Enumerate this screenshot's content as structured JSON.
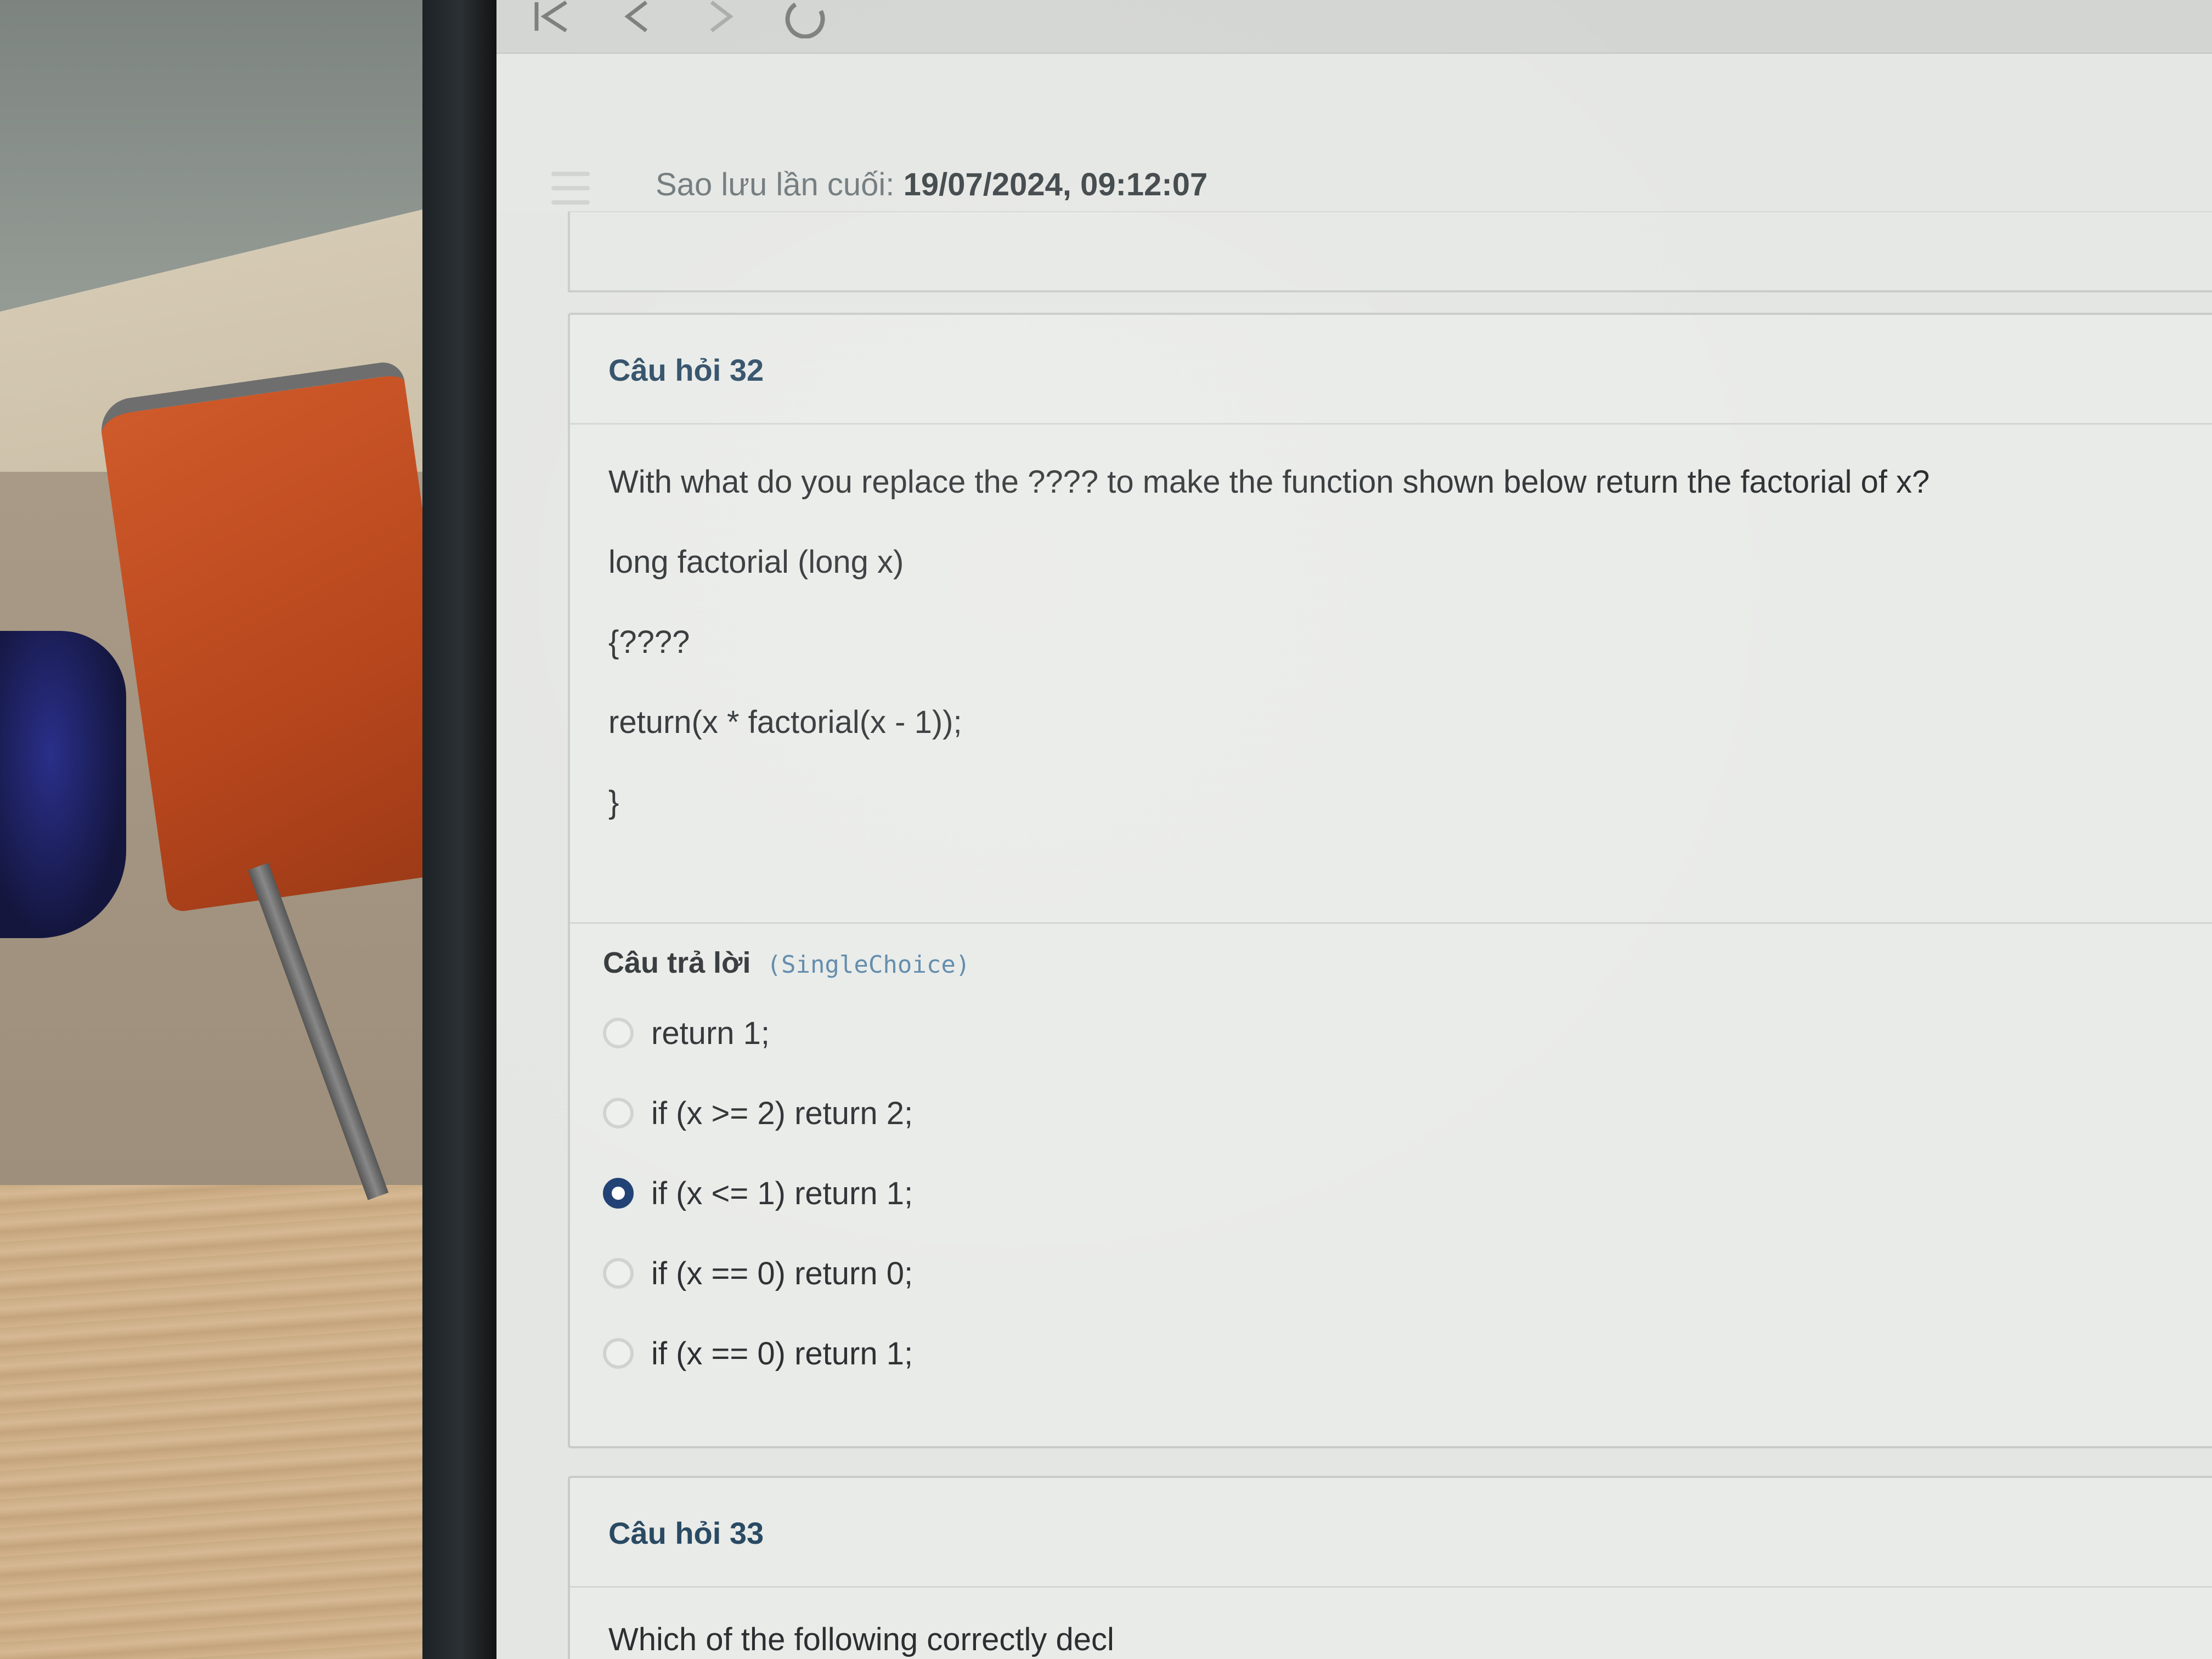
{
  "browser": {
    "icons": [
      "first-page-icon",
      "back-icon",
      "forward-icon",
      "reload-icon"
    ]
  },
  "header": {
    "save_label": "Sao lưu lần cuối:",
    "save_time": "19/07/2024, 09:12:07"
  },
  "question32": {
    "title": "Câu hỏi 32",
    "prompt": "With what do you replace the ???? to make the function shown below return the factorial of x?",
    "code_lines": [
      "long factorial (long x)",
      "{????",
      "return(x * factorial(x - 1));",
      "}"
    ],
    "answer_label": "Câu trả lời",
    "answer_type": "(SingleChoice)",
    "options": [
      {
        "text": "return 1;",
        "selected": false
      },
      {
        "text": "if (x >= 2) return 2;",
        "selected": false
      },
      {
        "text": "if (x <= 1) return 1;",
        "selected": true
      },
      {
        "text": "if (x == 0) return 0;",
        "selected": false
      },
      {
        "text": "if (x == 0) return 1;",
        "selected": false
      }
    ]
  },
  "question33": {
    "title": "Câu hỏi 33",
    "prompt_partial": "Which of the following correctly decl"
  },
  "colors": {
    "accent": "#1e3f73",
    "title_blue": "#2a4a63",
    "type_blue": "#5a86a8"
  }
}
